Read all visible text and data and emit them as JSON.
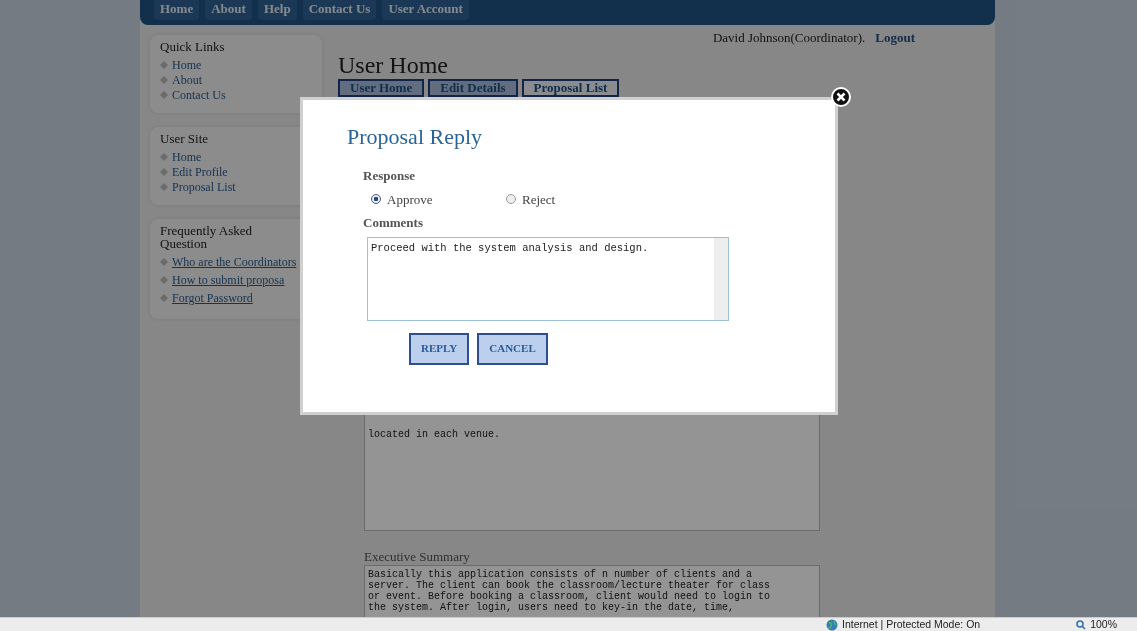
{
  "nav": {
    "items": [
      {
        "label": "Home"
      },
      {
        "label": "About"
      },
      {
        "label": "Help"
      },
      {
        "label": "Contact Us"
      },
      {
        "label": "User Account"
      }
    ]
  },
  "user_bar": {
    "name": "David Johnson(Coordinator).",
    "logout": "Logout"
  },
  "sidebar": [
    {
      "title": "Quick Links",
      "kind": "menu",
      "items": [
        "Home",
        "About",
        "Contact Us"
      ]
    },
    {
      "title": "User Site",
      "kind": "menu",
      "items": [
        "Home",
        "Edit Profile",
        "Proposal List"
      ]
    },
    {
      "title": "Frequently Asked Question",
      "kind": "faq",
      "items": [
        "Who are the Coordinators",
        "How to submit proposa",
        "Forgot Password"
      ]
    }
  ],
  "page": {
    "title": "User Home",
    "tabs": [
      {
        "label": "User Home",
        "selected": false
      },
      {
        "label": "Edit Details",
        "selected": false
      },
      {
        "label": "Proposal List",
        "selected": true
      }
    ]
  },
  "background_fields": [
    {
      "value": "located in each venue."
    },
    {
      "label": "Executive Summary",
      "value": "Basically this application consists of n number of clients and a\nserver. The client can book the classroom/lecture theater for class\nor event. Before booking a classroom, client would need to login to\nthe system. After login, users need to key-in the date, time,"
    }
  ],
  "modal": {
    "title": "Proposal Reply",
    "response_label": "Response",
    "options": [
      {
        "label": "Approve",
        "selected": true
      },
      {
        "label": "Reject",
        "selected": false
      }
    ],
    "comments_label": "Comments",
    "comments": "Proceed with the system analysis and design.",
    "buttons": [
      "REPLY",
      "CANCEL"
    ]
  },
  "status_bar": {
    "zone": "Internet | Protected Mode: On",
    "zoom": "100%"
  }
}
